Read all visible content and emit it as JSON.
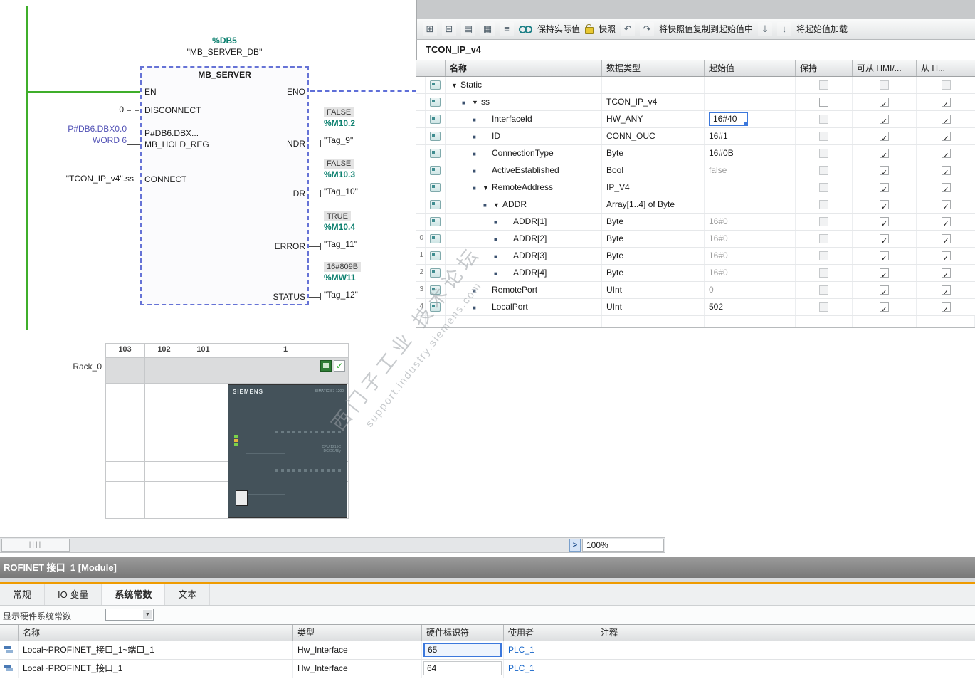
{
  "colors": {
    "accent_teal": "#0e8170",
    "selection_blue": "#3c78dc",
    "rail_green": "#3fae2a",
    "orange_bar": "#ef9b00",
    "link_blue": "#1464c8",
    "title_bar_gray": "#787878"
  },
  "fbd": {
    "db_instance": "%DB5",
    "db_name": "\"MB_SERVER_DB\"",
    "title": "MB_SERVER",
    "en": "EN",
    "eno": "ENO",
    "inputs": [
      {
        "pin": "DISCONNECT",
        "operands": [
          "0"
        ]
      },
      {
        "pin": "MB_HOLD_REG",
        "inner": "P#DB6.DBX...",
        "operands": [
          "P#DB6.DBX0.0",
          "WORD 6"
        ]
      },
      {
        "pin": "CONNECT",
        "operands": [
          "\"TCON_IP_v4\".ss"
        ]
      }
    ],
    "outputs": [
      {
        "pin": "NDR",
        "value": "FALSE",
        "address": "%M10.2",
        "tag": "\"Tag_9\""
      },
      {
        "pin": "DR",
        "value": "FALSE",
        "address": "%M10.3",
        "tag": "\"Tag_10\""
      },
      {
        "pin": "ERROR",
        "value": "TRUE",
        "address": "%M10.4",
        "tag": "\"Tag_11\""
      },
      {
        "pin": "STATUS",
        "value": "16#809B",
        "address": "%MW11",
        "tag": "\"Tag_12\""
      }
    ]
  },
  "watch_toolbar": {
    "items": [
      {
        "type": "icon",
        "name": "expand-members-icon",
        "glyph": "⊞"
      },
      {
        "type": "icon",
        "name": "collapse-members-icon",
        "glyph": "⊟"
      },
      {
        "type": "icon",
        "name": "keep-actual-values-icon",
        "glyph": "▤"
      },
      {
        "type": "icon",
        "name": "reset-start-values-icon",
        "glyph": "▦"
      },
      {
        "type": "icon",
        "name": "sort-icon",
        "glyph": "≡"
      },
      {
        "type": "goggles",
        "name": "monitor-all-icon"
      },
      {
        "type": "text",
        "name": "keep-actual-values-label",
        "text": "保持实际值"
      },
      {
        "type": "lock",
        "name": "lock-icon"
      },
      {
        "type": "text",
        "name": "snapshot-label",
        "text": "快照"
      },
      {
        "type": "icon",
        "name": "copy-snapshot-icon",
        "glyph": "↶"
      },
      {
        "type": "icon",
        "name": "copy-snapshot-alt-icon",
        "glyph": "↷"
      },
      {
        "type": "text",
        "name": "copy-snapshot-to-start-label",
        "text": "将快照值复制到起始值中"
      },
      {
        "type": "icon",
        "name": "load-start-values-icon",
        "glyph": "⇓"
      },
      {
        "type": "icon",
        "name": "load-start-values-alt-icon",
        "glyph": "↓"
      },
      {
        "type": "text",
        "name": "load-start-values-label",
        "text": "将起始值加载"
      }
    ]
  },
  "db_editor": {
    "title": "TCON_IP_v4",
    "columns": [
      "名称",
      "数据类型",
      "起始值",
      "保持",
      "可从 HMI/...",
      "从 H..."
    ],
    "rows": [
      {
        "num": "",
        "level": 0,
        "bullet": false,
        "exp": true,
        "name": "Static",
        "dtype": "",
        "start": "",
        "gray": false,
        "sel": false,
        "retain": "light",
        "hmi": "light",
        "h": "light"
      },
      {
        "num": "",
        "level": 1,
        "bullet": true,
        "exp": true,
        "name": "ss",
        "dtype": "TCON_IP_v4",
        "start": "",
        "gray": false,
        "sel": false,
        "retain": "plain",
        "hmi": "checked",
        "h": "checked"
      },
      {
        "num": "",
        "level": 2,
        "bullet": true,
        "exp": false,
        "name": "InterfaceId",
        "dtype": "HW_ANY",
        "start": "16#40",
        "gray": false,
        "sel": true,
        "retain": "light",
        "hmi": "checked",
        "h": "checked"
      },
      {
        "num": "",
        "level": 2,
        "bullet": true,
        "exp": false,
        "name": "ID",
        "dtype": "CONN_OUC",
        "start": "16#1",
        "gray": false,
        "sel": false,
        "retain": "light",
        "hmi": "checked",
        "h": "checked"
      },
      {
        "num": "",
        "level": 2,
        "bullet": true,
        "exp": false,
        "name": "ConnectionType",
        "dtype": "Byte",
        "start": "16#0B",
        "gray": false,
        "sel": false,
        "retain": "light",
        "hmi": "checked",
        "h": "checked"
      },
      {
        "num": "",
        "level": 2,
        "bullet": true,
        "exp": false,
        "name": "ActiveEstablished",
        "dtype": "Bool",
        "start": "false",
        "gray": true,
        "sel": false,
        "retain": "light",
        "hmi": "checked",
        "h": "checked"
      },
      {
        "num": "",
        "level": 2,
        "bullet": true,
        "exp": true,
        "name": "RemoteAddress",
        "dtype": "IP_V4",
        "start": "",
        "gray": false,
        "sel": false,
        "retain": "light",
        "hmi": "checked",
        "h": "checked"
      },
      {
        "num": "",
        "level": 3,
        "bullet": true,
        "exp": true,
        "name": "ADDR",
        "dtype": "Array[1..4] of Byte",
        "start": "",
        "gray": false,
        "sel": false,
        "retain": "light",
        "hmi": "checked",
        "h": "checked"
      },
      {
        "num": "",
        "level": 4,
        "bullet": true,
        "exp": false,
        "name": "ADDR[1]",
        "dtype": "Byte",
        "start": "16#0",
        "gray": true,
        "sel": false,
        "retain": "light",
        "hmi": "checked",
        "h": "checked"
      },
      {
        "num": "0",
        "level": 4,
        "bullet": true,
        "exp": false,
        "name": "ADDR[2]",
        "dtype": "Byte",
        "start": "16#0",
        "gray": true,
        "sel": false,
        "retain": "light",
        "hmi": "checked",
        "h": "checked"
      },
      {
        "num": "1",
        "level": 4,
        "bullet": true,
        "exp": false,
        "name": "ADDR[3]",
        "dtype": "Byte",
        "start": "16#0",
        "gray": true,
        "sel": false,
        "retain": "light",
        "hmi": "checked",
        "h": "checked"
      },
      {
        "num": "2",
        "level": 4,
        "bullet": true,
        "exp": false,
        "name": "ADDR[4]",
        "dtype": "Byte",
        "start": "16#0",
        "gray": true,
        "sel": false,
        "retain": "light",
        "hmi": "checked",
        "h": "checked"
      },
      {
        "num": "3",
        "level": 2,
        "bullet": true,
        "exp": false,
        "name": "RemotePort",
        "dtype": "UInt",
        "start": "0",
        "gray": true,
        "sel": false,
        "retain": "light",
        "hmi": "checked",
        "h": "checked"
      },
      {
        "num": "4",
        "level": 2,
        "bullet": true,
        "exp": false,
        "name": "LocalPort",
        "dtype": "UInt",
        "start": "502",
        "gray": false,
        "sel": false,
        "retain": "light",
        "hmi": "checked",
        "h": "checked"
      }
    ]
  },
  "device_view": {
    "rack_label": "Rack_0",
    "slot_headers": [
      "103",
      "102",
      "101",
      "1"
    ],
    "cpu_brand": "SIEMENS",
    "cpu_series": "SIMATIC S7-1200",
    "cpu_model_line1": "CPU 1215C",
    "cpu_model_line2": "DC/DC/Rly",
    "scroll_handle": "||||",
    "next_button": ">",
    "zoom": "100%"
  },
  "properties": {
    "title": "ROFINET 接口_1 [Module]",
    "tabs": [
      {
        "label": "常规",
        "active": false
      },
      {
        "label": "IO 变量",
        "active": false
      },
      {
        "label": "系统常数",
        "active": true
      },
      {
        "label": "文本",
        "active": false
      }
    ],
    "filter_label": "显示硬件系统常数",
    "columns": [
      "名称",
      "类型",
      "硬件标识符",
      "使用者",
      "注释"
    ],
    "rows": [
      {
        "name": "Local~PROFINET_接口_1~端口_1",
        "type": "Hw_Interface",
        "hw_id": "65",
        "user": "PLC_1",
        "comment": ""
      },
      {
        "name": "Local~PROFINET_接口_1",
        "type": "Hw_Interface",
        "hw_id": "64",
        "user": "PLC_1",
        "comment": ""
      }
    ]
  },
  "watermark": {
    "line1": "西门子工业 技术论坛",
    "line2": "support.industry.siemens.com"
  }
}
